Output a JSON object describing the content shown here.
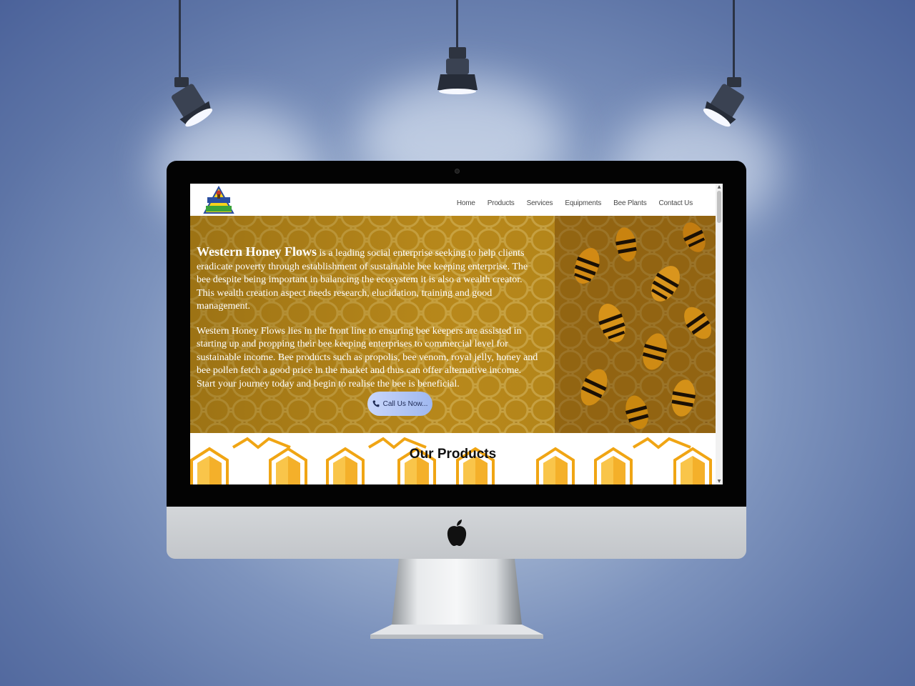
{
  "site": {
    "logo_alt": "Western Honey Flows logo",
    "nav": [
      "Home",
      "Products",
      "Services",
      "Equipments",
      "Bee Plants",
      "Contact Us"
    ],
    "hero": {
      "brand": "Western Honey Flows",
      "paragraph1_rest": " is a leading social enterprise seeking to help clients eradicate poverty through establishment of sustainable bee keeping enterprise. The bee despite being important in balancing the ecosystem it is also a wealth creator. This wealth creation aspect needs research, elucidation, training and good management.",
      "paragraph2": "Western Honey Flows lies in the front line to ensuring bee keepers are assisted in starting up and propping their bee keeping enterprises to commercial level for sustainable income. Bee products such as propolis, bee venom, royal jelly, honey and bee pollen fetch a good price in the market and thus can offer alternative income. Start your journey today and begin to realise the bee is beneficial.",
      "call_button": "Call Us Now..."
    },
    "products_title": "Our Products"
  },
  "colors": {
    "background": "#5d74a6",
    "honey": "#f0a514",
    "button": "#b4c8f6"
  },
  "icons": [
    "spotlight-icon",
    "phone-icon",
    "apple-logo-icon",
    "scroll-up-icon",
    "scroll-down-icon"
  ]
}
